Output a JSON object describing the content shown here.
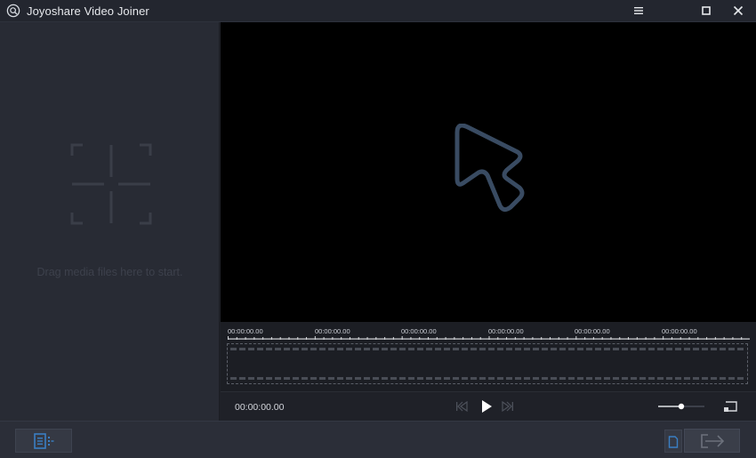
{
  "app": {
    "title": "Joyoshare Video Joiner",
    "logo_icon": "joyoshare-logo-icon"
  },
  "window_controls": {
    "menu_icon": "hamburger-menu-icon",
    "maximize_icon": "maximize-icon",
    "close_icon": "close-icon"
  },
  "media_panel": {
    "drop_icon": "add-media-crosshair-icon",
    "drop_text": "Drag media files here to start."
  },
  "preview": {
    "logo_icon": "joyoshare-play-logo-icon",
    "background": "#000000"
  },
  "timeline": {
    "tick_labels": [
      "00:00:00.00",
      "00:00:00.00",
      "00:00:00.00",
      "00:00:00.00",
      "00:00:00.00",
      "00:00:00.00"
    ]
  },
  "playback": {
    "timecode": "00:00:00.00",
    "prev_icon": "skip-previous-icon",
    "play_icon": "play-icon",
    "next_icon": "skip-next-icon",
    "volume_level": 0.5,
    "fit_icon": "fit-screen-icon"
  },
  "bottom_bar": {
    "list_icon": "media-list-icon",
    "file_icon": "file-icon",
    "convert_icon": "convert-arrow-icon"
  },
  "colors": {
    "accent": "#3a7fc4",
    "titlebar": "#23262f",
    "panel": "#282b34"
  }
}
